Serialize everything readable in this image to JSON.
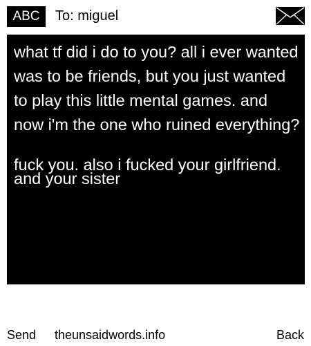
{
  "header": {
    "input_mode": "ABC",
    "recipient_label": "To: miguel",
    "envelope_icon": "envelope-icon"
  },
  "message": {
    "text": "what tf did i do to you? all i ever wanted was to be friends, but you just wanted to play this little mental games. and now i'm the one who ruined everything?",
    "overlap_text": "fuck you. also i fucked your girlfriend. and your sister"
  },
  "footer": {
    "left_softkey": "Send",
    "site": "theunsaidwords.info",
    "right_softkey": "Back"
  },
  "colors": {
    "background": "#ffffff",
    "message_background": "#000000",
    "message_text": "#ffffff",
    "ui_text": "#000000"
  }
}
